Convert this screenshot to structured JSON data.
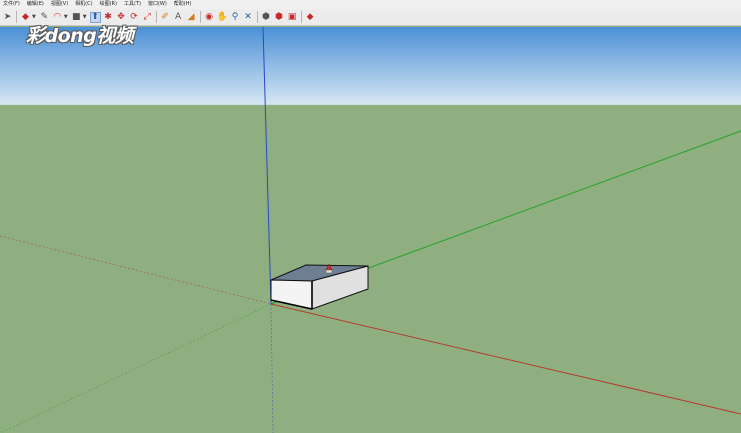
{
  "menubar": {
    "items": [
      "文件(F)",
      "编辑(E)",
      "视图(V)",
      "相机(C)",
      "绘图(R)",
      "工具(T)",
      "窗口(W)",
      "帮助(H)"
    ]
  },
  "toolbar": {
    "tools": [
      {
        "name": "select-tool-button",
        "icon": "arrow-cursor-icon",
        "glyph": "➤",
        "active": false
      },
      {
        "name": "eraser-tool-button",
        "icon": "eraser-icon",
        "glyph": "◆",
        "active": false,
        "color": "red"
      },
      {
        "name": "pencil-tool-button",
        "icon": "pencil-icon",
        "glyph": "✎",
        "active": false
      },
      {
        "name": "arc-tool-button",
        "icon": "arc-icon",
        "glyph": "◠",
        "active": false,
        "color": "red"
      },
      {
        "name": "shape-tool-button",
        "icon": "rectangle-icon",
        "glyph": "■",
        "active": false
      },
      {
        "name": "push-pull-tool-button",
        "icon": "push-pull-icon",
        "glyph": "⬆",
        "active": true,
        "color": "blue"
      },
      {
        "name": "follow-me-tool-button",
        "icon": "follow-me-icon",
        "glyph": "✱",
        "active": false,
        "color": "red"
      },
      {
        "name": "move-tool-button",
        "icon": "move-icon",
        "glyph": "✥",
        "active": false,
        "color": "red"
      },
      {
        "name": "rotate-tool-button",
        "icon": "rotate-icon",
        "glyph": "⟳",
        "active": false,
        "color": "red"
      },
      {
        "name": "scale-tool-button",
        "icon": "scale-icon",
        "glyph": "⤢",
        "active": false,
        "color": "red"
      },
      {
        "name": "tape-measure-tool-button",
        "icon": "tape-measure-icon",
        "glyph": "✐",
        "active": false,
        "color": "orange"
      },
      {
        "name": "text-tool-button",
        "icon": "text-label-icon",
        "glyph": "A",
        "active": false
      },
      {
        "name": "paint-bucket-tool-button",
        "icon": "paint-bucket-icon",
        "glyph": "◢",
        "active": false,
        "color": "orange"
      },
      {
        "name": "orbit-tool-button",
        "icon": "orbit-icon",
        "glyph": "◉",
        "active": false,
        "color": "red"
      },
      {
        "name": "pan-tool-button",
        "icon": "pan-hand-icon",
        "glyph": "✋",
        "active": false,
        "color": "orange"
      },
      {
        "name": "zoom-tool-button",
        "icon": "zoom-icon",
        "glyph": "⚲",
        "active": false,
        "color": "blue"
      },
      {
        "name": "zoom-extents-tool-button",
        "icon": "zoom-extents-icon",
        "glyph": "✕",
        "active": false,
        "color": "blue"
      },
      {
        "name": "warehouse-button",
        "icon": "warehouse-icon",
        "glyph": "⬢",
        "active": false
      },
      {
        "name": "extension-warehouse-button",
        "icon": "extension-icon",
        "glyph": "⬢",
        "active": false,
        "color": "red"
      },
      {
        "name": "layout-button",
        "icon": "layout-icon",
        "glyph": "▣",
        "active": false,
        "color": "red"
      },
      {
        "name": "ruby-console-button",
        "icon": "ruby-gem-icon",
        "glyph": "◆",
        "active": false,
        "color": "red"
      }
    ]
  },
  "watermark": {
    "text": "彩dong视频"
  },
  "colors": {
    "sky_top": "#4b90d6",
    "sky_bottom": "#d7e7f3",
    "ground": "#8faf80",
    "axis_red": "#b43c2f",
    "axis_green": "#21a02a",
    "axis_blue": "#2a47c8",
    "box_top": "#6f7f93",
    "box_face": "#f4f4f4",
    "box_side": "#e0e0e0"
  }
}
